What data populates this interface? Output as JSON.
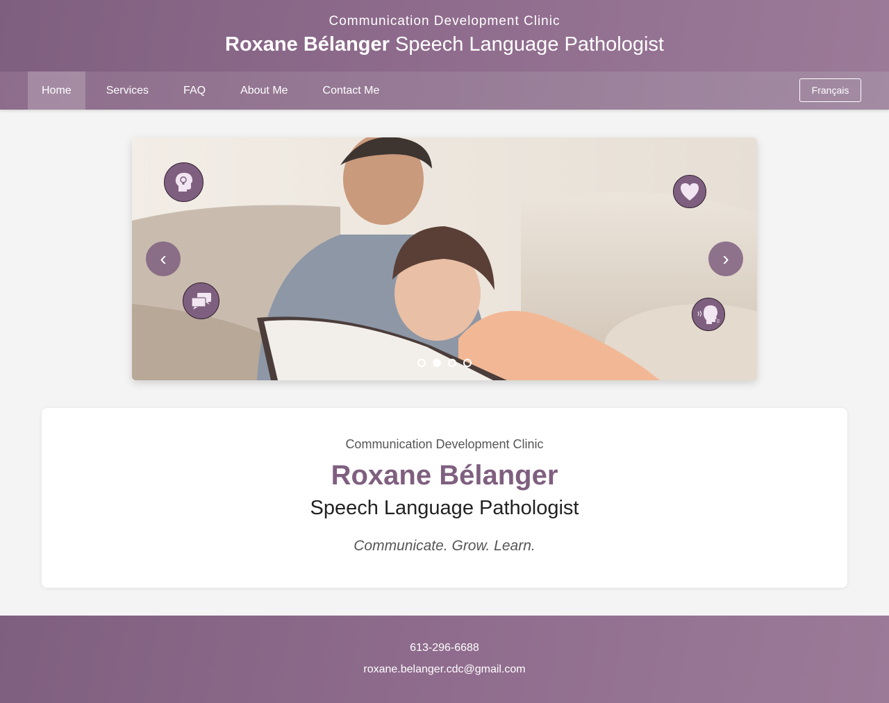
{
  "header": {
    "clinic": "Communication Development Clinic",
    "name": "Roxane Bélanger",
    "role": "Speech Language Pathologist"
  },
  "nav": {
    "items": [
      {
        "label": "Home",
        "active": true
      },
      {
        "label": "Services"
      },
      {
        "label": "FAQ"
      },
      {
        "label": "About Me"
      },
      {
        "label": "Contact Me"
      }
    ],
    "lang_button": "Français"
  },
  "carousel": {
    "prev_label": "‹",
    "next_label": "›",
    "active_slide": 2,
    "slide_count": 4,
    "icons": [
      "head-bulb-icon",
      "heart-icon",
      "speech-bubbles-icon",
      "speaking-head-icon"
    ]
  },
  "intro": {
    "clinic": "Communication Development Clinic",
    "name": "Roxane Bélanger",
    "role": "Speech Language Pathologist",
    "tagline": "Communicate. Grow. Learn."
  },
  "footer": {
    "phone": "613-296-6688",
    "email": "roxane.belanger.cdc@gmail.com"
  },
  "colors": {
    "brand": "#7f5f7f",
    "brand_light": "#a38ba3",
    "background": "#f4f4f4"
  }
}
